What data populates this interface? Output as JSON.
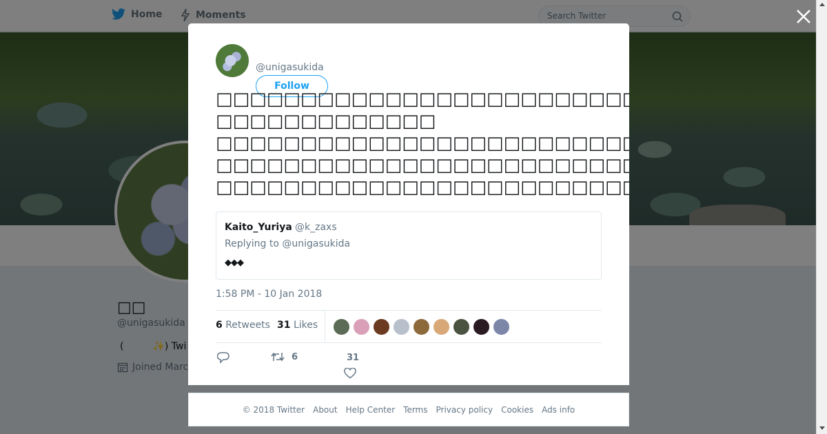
{
  "nav": {
    "home_label": "Home",
    "moments_label": "Moments",
    "search_placeholder": "Search Twitter"
  },
  "background_profile": {
    "name": "□□",
    "handle": "@unigasukida",
    "bio": "(　　　✨) Twi",
    "joined": "Joined Marc"
  },
  "tweet": {
    "author_handle": "@unigasukida",
    "follow_label": "Follow",
    "text_lines": [
      "□□□□□□□□□□□□□□□□□□□□□□□□□",
      "□□□□□□□□□□□□□",
      "□□□□□□□□□□□□□□□□□□□□□□□□□□□□□□□□",
      "□□□□□□□□□□□□□□□□□□□□□□□□□□□□□□□□□□□□□□□□□□□",
      "□□□□□□□□□□□□□□□□□□□□□□□□□□□□□□□□□□□□□□□□□□"
    ],
    "timestamp": "1:58 PM - 10 Jan 2018",
    "retweets_count": "6",
    "retweets_label": "Retweets",
    "likes_count": "31",
    "likes_label": "Likes",
    "action_retweet_count": "6",
    "action_like_count": "31"
  },
  "quoted_reply": {
    "name": "Kaito_Yuriya",
    "handle": "@k_zaxs",
    "replying_prefix": "Replying to",
    "replying_to": "@unigasukida",
    "body": "◆◆◆"
  },
  "likers": [
    {
      "color": "#5b6b55"
    },
    {
      "color": "#d9a0b8"
    },
    {
      "color": "#6b3a20"
    },
    {
      "color": "#b8c0cc"
    },
    {
      "color": "#8c6a3c"
    },
    {
      "color": "#d8a878"
    },
    {
      "color": "#4a5240"
    },
    {
      "color": "#2a1a22"
    },
    {
      "color": "#7c86a8"
    }
  ],
  "footer": {
    "copyright": "© 2018 Twitter",
    "links": [
      "About",
      "Help Center",
      "Terms",
      "Privacy policy",
      "Cookies",
      "Ads info"
    ]
  },
  "colors": {
    "accent": "#1da1f2",
    "muted": "#657786"
  }
}
